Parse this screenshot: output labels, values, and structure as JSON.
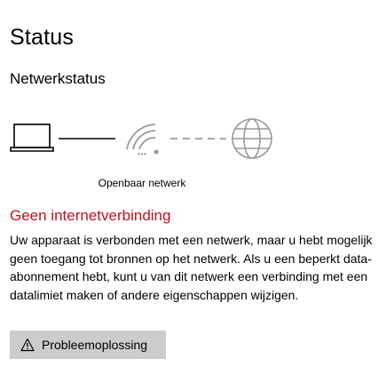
{
  "page": {
    "title": "Status"
  },
  "network_status": {
    "heading": "Netwerkstatus",
    "network_name": "...",
    "network_type": "Openbaar netwerk"
  },
  "icons": {
    "device": "laptop-icon",
    "network": "wifi-icon",
    "internet": "globe-icon",
    "warning": "warning-icon"
  },
  "error": {
    "title": "Geen internetverbinding",
    "description": "Uw apparaat is verbonden met een netwerk, maar u hebt mogelijk geen toegang tot bronnen op het netwerk. Als u een beperkt data-abonnement hebt, kunt u van dit netwerk een verbinding met een datalimiet maken of andere eigenschappen wijzigen."
  },
  "actions": {
    "troubleshoot_label": "Probleemoplossing"
  },
  "colors": {
    "error": "#c50f1f",
    "icon_active": "#000000",
    "icon_inactive": "#999999",
    "button_bg": "#cccccc"
  }
}
